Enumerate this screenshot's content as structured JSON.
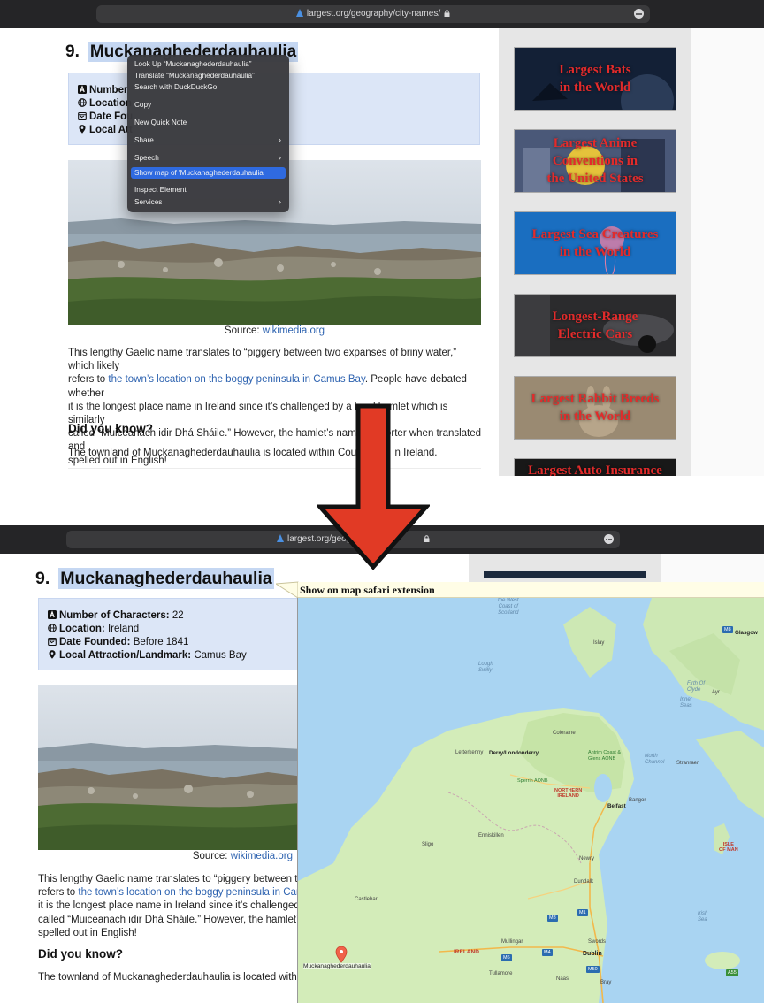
{
  "browser": {
    "url_top": "largest.org/geography/city-names/",
    "url_bottom": "largest.org/geogr"
  },
  "article": {
    "rank": "9.",
    "name": "Muckanaghederdauhaulia",
    "facts": {
      "characters_label": "Number of Characters:",
      "characters_value": "22",
      "location_label": "Location:",
      "location_value": "Ireland",
      "founded_label": "Date Founded:",
      "founded_value": "Before 1841",
      "attraction_label": "Local Attraction/Landmark:",
      "attraction_value": "Camus Bay"
    },
    "facts_cut": {
      "characters_label": "Number",
      "location_label": "Location",
      "founded_label": "Date Fou",
      "attraction_label": "Local Att"
    },
    "caption_prefix": "Source:",
    "caption_link": "wikimedia.org",
    "paragraph_top": {
      "p1": "This lengthy Gaelic name translates to “piggery between two expanses of briny water,” which likely",
      "p2_prefix": "refers to",
      "p2_link": "the town’s location on the boggy peninsula in Camus Bay",
      "p2_suffix": ". People have debated whether",
      "p3": "it is the longest place name in Ireland since it’s challenged by a local hamlet which is similarly",
      "p4": "called “Muiceanach idir Dhá Sháile.” However, the hamlet’s name is shorter when translated and",
      "p5": "spelled out in English!"
    },
    "paragraph_bottom": {
      "p1": "This lengthy Gaelic name translates to “piggery between two e",
      "p2_prefix": "refers to",
      "p2_link": "the town’s location on the boggy peninsula in Camus",
      "p3": "it is the longest place name in Ireland since it’s challenged by",
      "p4": "called “Muiceanach idir Dhá Sháile.” However, the hamlet’s na",
      "p5": "spelled out in English!"
    },
    "did_you_know": "Did you know?",
    "townland_top_a": "The townland of Muckanaghederdauhaulia is located within County G",
    "townland_top_b": "n Ireland.",
    "townland_bottom": "The townland of Muckanaghederdauhaulia is located within C"
  },
  "context_menu": {
    "look_up": "Look Up “Muckanaghederdauhaulia”",
    "translate": "Translate “Muckanaghederdauhaulia”",
    "search": "Search with DuckDuckGo",
    "copy": "Copy",
    "quick_note": "New Quick Note",
    "share": "Share",
    "speech": "Speech",
    "show_map": "Show map of 'Muckanaghederdauhaulia'",
    "inspect": "Inspect Element",
    "services": "Services"
  },
  "sidebar": {
    "banners": [
      {
        "line1": "Largest Bats",
        "line2": "in the World",
        "line3": "",
        "color": "#1c2a3d"
      },
      {
        "line1": "Largest Anime",
        "line2": "Conventions in",
        "line3": "the United States",
        "color": "#3e4a6b"
      },
      {
        "line1": "Largest Sea Creatures",
        "line2": "in the World",
        "line3": "",
        "color": "#1a68b4"
      },
      {
        "line1": "Longest-Range",
        "line2": "Electric Cars",
        "line3": "",
        "color": "#2a2a2c"
      },
      {
        "line1": "Largest Rabbit Breeds",
        "line2": "in the World",
        "line3": "",
        "color": "#8a7a66"
      },
      {
        "line1": "Largest Auto Insurance",
        "line2": "",
        "line3": "",
        "color": "#181818"
      }
    ]
  },
  "popup": {
    "title": "Show on map safari extension",
    "marker_label": "Muckanaghederdauhaulia"
  },
  "map": {
    "labels": {
      "west_coast": "the West",
      "west_coast2": "Coast of",
      "west_coast3": "Scotland",
      "glasgow": "Glasgow",
      "islay": "Islay",
      "lough_swilly": "Lough",
      "lough_swilly2": "Swilly",
      "firth": "Firth Of",
      "firth2": "Clyde",
      "ayr": "Ayr",
      "inner_seas": "Inner",
      "inner_seas2": "Seas",
      "coleraine": "Coleraine",
      "letterkenny": "Letterkenny",
      "derry": "Derry/Londonderry",
      "antrim": "Antrim Coast &",
      "antrim2": "Glens AONB",
      "north_channel": "North",
      "north_channel2": "Channel",
      "stranraer": "Stranraer",
      "sperrin": "Sperrin AONB",
      "ni": "NORTHERN",
      "ni2": "IRELAND",
      "belfast": "Belfast",
      "bangor": "Bangor",
      "enniskillen": "Enniskillen",
      "sligo": "Sligo",
      "isle_of_man": "ISLE",
      "isle_of_man2": "OF MAN",
      "newry": "Newry",
      "dundalk": "Dundalk",
      "irish_sea": "Irish",
      "irish_sea2": "Sea",
      "castlebar": "Castlebar",
      "mullingar": "Mullingar",
      "ireland": "IRELAND",
      "swords": "Swords",
      "dublin": "Dublin",
      "tullamore": "Tullamore",
      "naas": "Naas",
      "bray": "Bray"
    },
    "roads": [
      "M8",
      "M3",
      "M1",
      "M6",
      "M4",
      "M50",
      "A55"
    ]
  }
}
